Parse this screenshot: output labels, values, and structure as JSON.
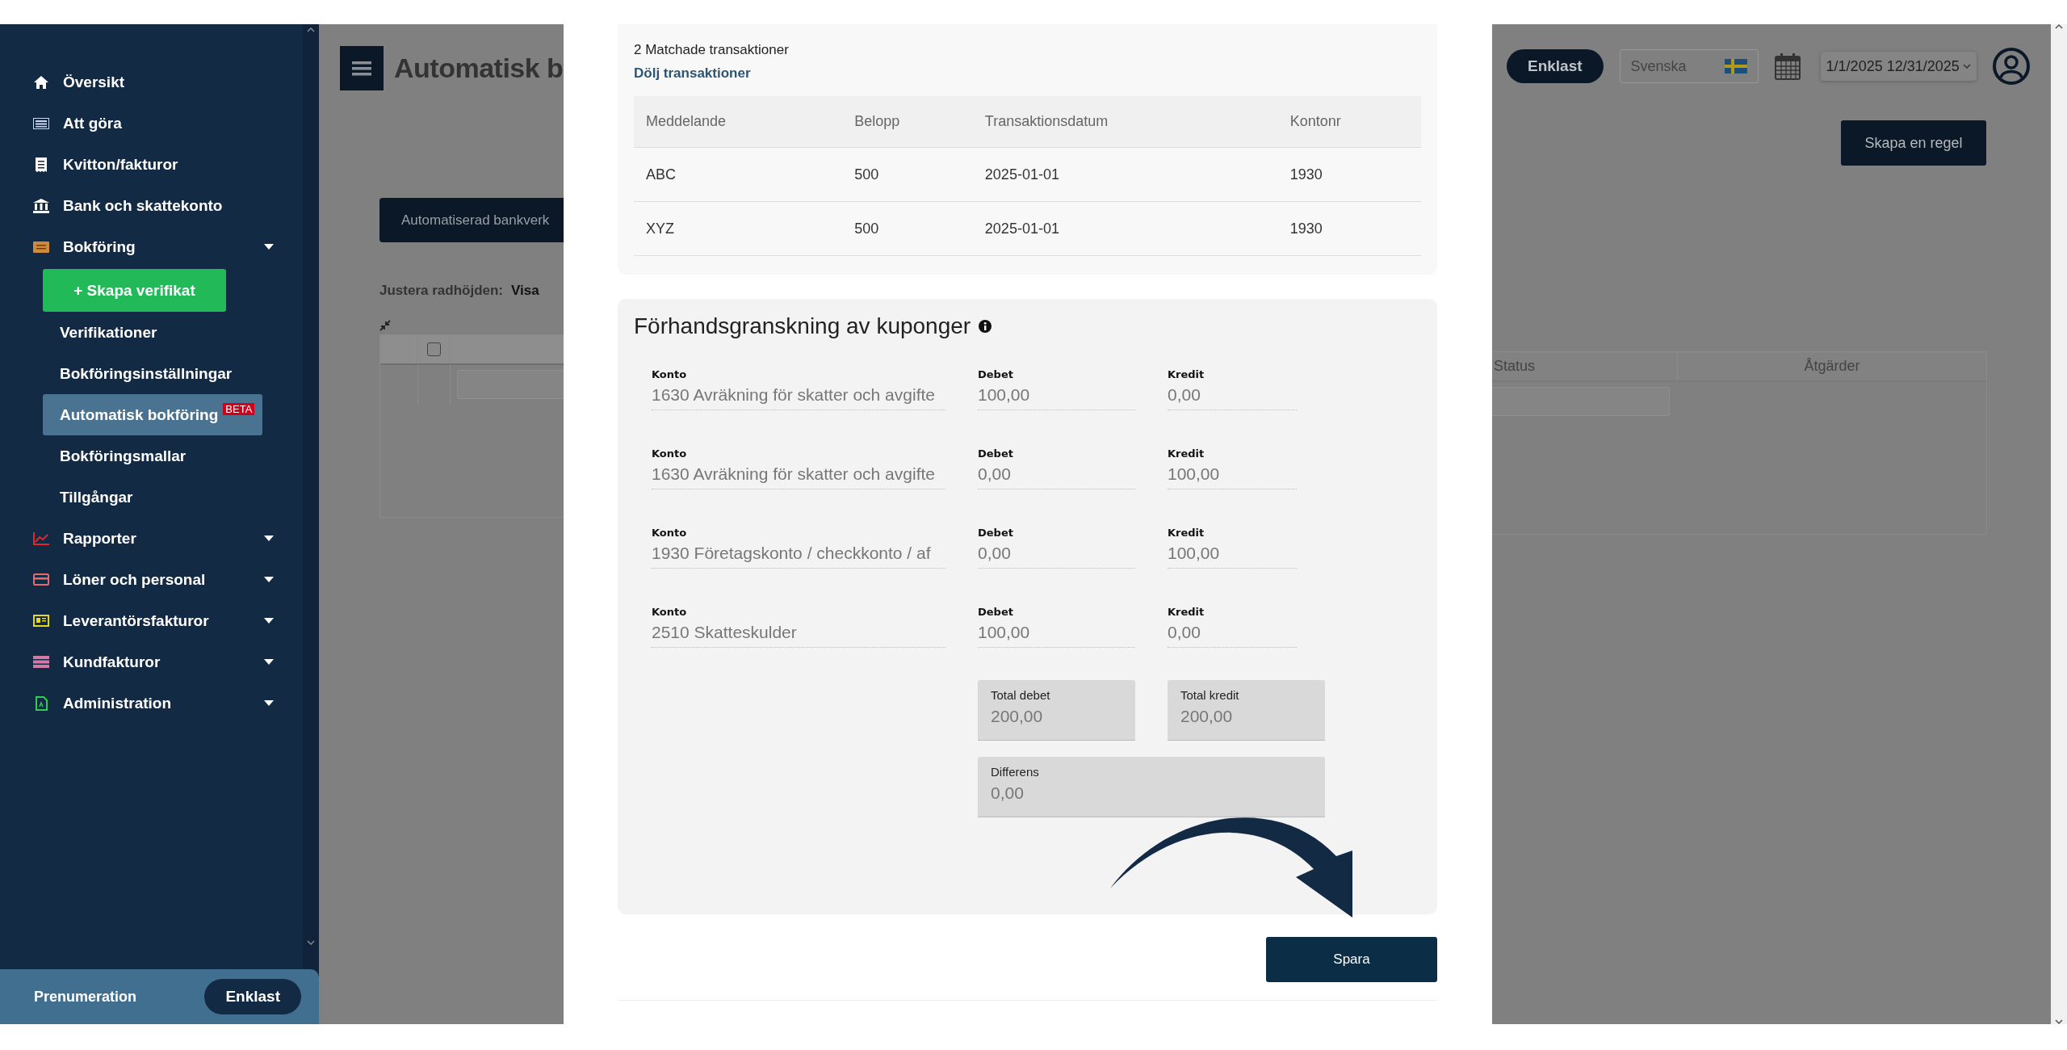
{
  "sidebar": {
    "items": [
      {
        "label": "Översikt",
        "collapsible": false
      },
      {
        "label": "Att göra",
        "collapsible": false
      },
      {
        "label": "Kvitton/fakturor",
        "collapsible": false
      },
      {
        "label": "Bank och skattekonto",
        "collapsible": false
      },
      {
        "label": "Bokföring",
        "collapsible": true,
        "children": [
          {
            "kind": "button",
            "label": "+ Skapa verifikat",
            "selected": false
          },
          {
            "kind": "link",
            "label": "Verifikationer",
            "selected": false
          },
          {
            "kind": "link",
            "label": "Bokföringsinställningar",
            "selected": false
          },
          {
            "kind": "link",
            "label": "Automatisk bokföring",
            "badge": "BETA",
            "selected": true
          },
          {
            "kind": "link",
            "label": "Bokföringsmallar",
            "selected": false
          },
          {
            "kind": "link",
            "label": "Tillgångar",
            "selected": false
          }
        ]
      },
      {
        "label": "Rapporter",
        "collapsible": true
      },
      {
        "label": "Löner och personal",
        "collapsible": true
      },
      {
        "label": "Leverantörsfakturor",
        "collapsible": true
      },
      {
        "label": "Kundfakturor",
        "collapsible": true
      },
      {
        "label": "Administration",
        "collapsible": true
      }
    ],
    "footer": {
      "label": "Prenumeration",
      "plan": "Enklast"
    }
  },
  "page": {
    "title": "Automatisk b",
    "tab": "Automatiserad bankverk",
    "row_height_label": "Justera radhöjden:",
    "row_height_value": "Visa",
    "header_checkbox": {
      "checked": false
    },
    "columns": [
      "Status",
      "Åtgärder"
    ],
    "plan_badge": "Enklast",
    "language": "Svenska",
    "date_range": "1/1/2025 12/31/2025",
    "create_rule_button": "Skapa en regel"
  },
  "modal": {
    "matched_count": "2 Matchade transaktioner",
    "toggle_link": "Dölj transaktioner",
    "transactions": {
      "columns": [
        "Meddelande",
        "Belopp",
        "Transaktionsdatum",
        "Kontonr"
      ],
      "rows": [
        [
          "ABC",
          "500",
          "2025-01-01",
          "1930"
        ],
        [
          "XYZ",
          "500",
          "2025-01-01",
          "1930"
        ]
      ]
    },
    "preview": {
      "title": "Förhandsgranskning av kuponger",
      "lines": [
        {
          "konto_label": "Konto",
          "konto": "1630 Avräkning för skatter och avgifte",
          "debet_label": "Debet",
          "debet": "100,00",
          "kredit_label": "Kredit",
          "kredit": "0,00"
        },
        {
          "konto_label": "Konto",
          "konto": "1630 Avräkning för skatter och avgifte",
          "debet_label": "Debet",
          "debet": "0,00",
          "kredit_label": "Kredit",
          "kredit": "100,00"
        },
        {
          "konto_label": "Konto",
          "konto": "1930 Företagskonto / checkkonto / af",
          "debet_label": "Debet",
          "debet": "0,00",
          "kredit_label": "Kredit",
          "kredit": "100,00"
        },
        {
          "konto_label": "Konto",
          "konto": "2510 Skatteskulder",
          "debet_label": "Debet",
          "debet": "100,00",
          "kredit_label": "Kredit",
          "kredit": "0,00"
        }
      ],
      "total_debet_label": "Total debet",
      "total_debet": "200,00",
      "total_kredit_label": "Total kredit",
      "total_kredit": "200,00",
      "difference_label": "Differens",
      "difference": "0,00"
    },
    "save_button": "Spara"
  }
}
